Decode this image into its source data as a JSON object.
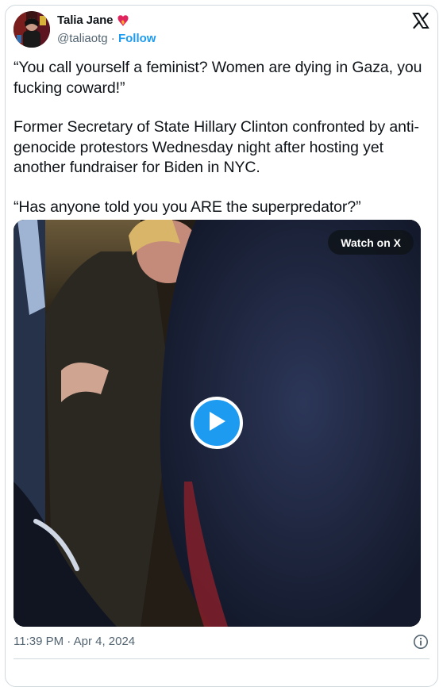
{
  "author": {
    "name": "Talia Jane",
    "handle": "@taliaotg",
    "separator": "·",
    "follow_label": "Follow",
    "badge_icon": "heart-fire-icon"
  },
  "brand_icon": "x-logo-icon",
  "tweet": {
    "paragraphs": [
      "“You call yourself a feminist? Women are dying in Gaza, you fucking coward!”",
      "Former Secretary of State Hillary Clinton confronted by anti-genocide protestors Wednesday night after hosting yet another fundraiser for Biden in NYC.",
      "“Has anyone told you you ARE the superpredator?”"
    ]
  },
  "media": {
    "watch_label": "Watch on X",
    "play_icon": "play-icon"
  },
  "footer": {
    "timestamp": "11:39 PM · Apr 4, 2024",
    "info_icon": "info-icon"
  },
  "colors": {
    "accent": "#1d9bf0",
    "text": "#0f1419",
    "muted": "#536471",
    "border": "#cfd9de"
  }
}
